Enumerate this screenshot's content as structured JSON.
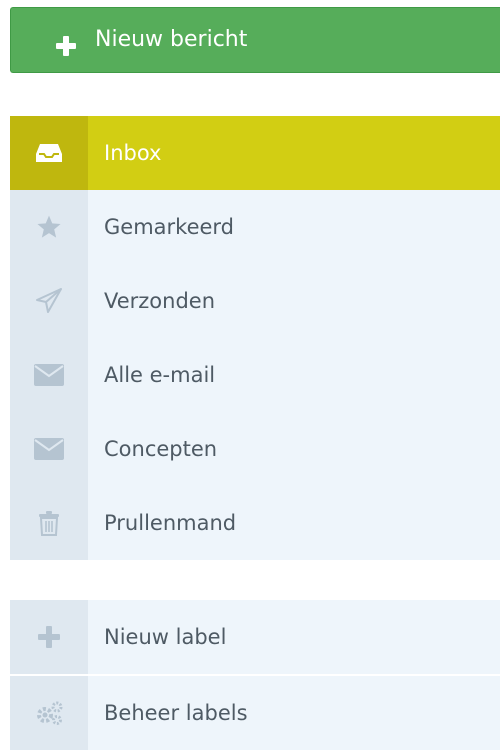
{
  "compose": {
    "label": "Nieuw bericht",
    "icon": "plus-icon"
  },
  "folders": [
    {
      "label": "Inbox",
      "icon": "inbox-icon",
      "active": true
    },
    {
      "label": "Gemarkeerd",
      "icon": "star-icon",
      "active": false
    },
    {
      "label": "Verzonden",
      "icon": "paper-plane-icon",
      "active": false
    },
    {
      "label": "Alle e-mail",
      "icon": "envelope-icon",
      "active": false
    },
    {
      "label": "Concepten",
      "icon": "envelope-icon",
      "active": false
    },
    {
      "label": "Prullenmand",
      "icon": "trash-icon",
      "active": false
    }
  ],
  "labels_section": [
    {
      "label": "Nieuw label",
      "icon": "plus-icon"
    },
    {
      "label": "Beheer labels",
      "icon": "gears-icon"
    }
  ],
  "colors": {
    "compose_green": "#56ad5a",
    "active_yellow": "#d2ce13",
    "row_bg": "#eef5fb",
    "icon_cell_bg": "#dfe8f0",
    "text": "#4e5a64",
    "icon_muted": "#b5c4d1"
  }
}
